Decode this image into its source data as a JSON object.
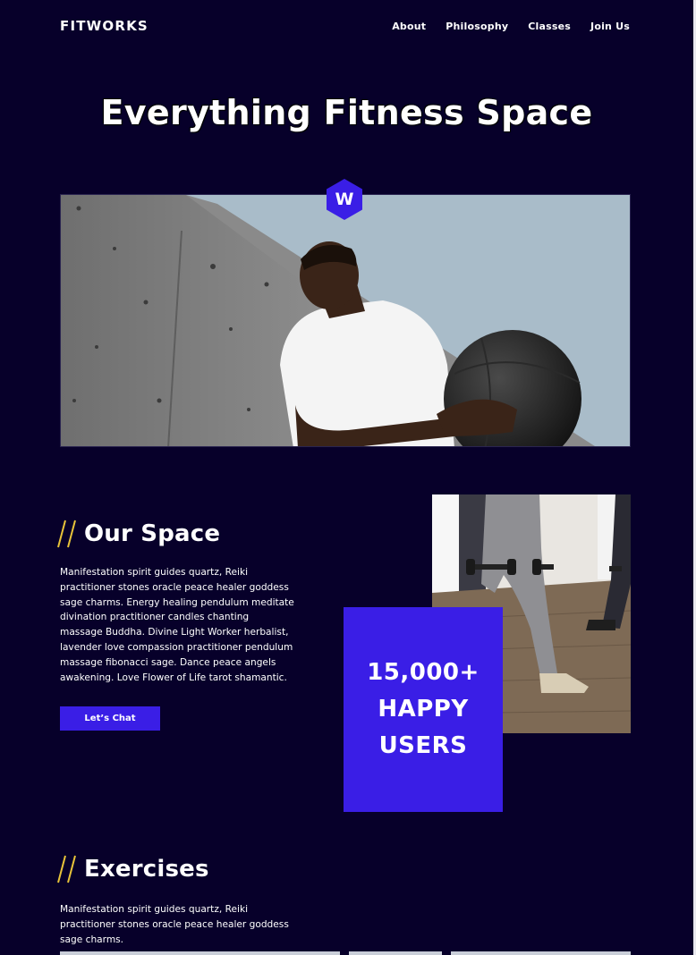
{
  "header": {
    "logo": "FITWORKS",
    "nav": [
      "About",
      "Philosophy",
      "Classes",
      "Join Us"
    ]
  },
  "hero": {
    "title": "Everything Fitness Space",
    "badge_letter": "W",
    "image_icon": "man-with-medicine-ball-photo"
  },
  "space": {
    "title": "Our Space",
    "text": "Manifestation spirit guides quartz, Reiki practitioner stones oracle peace healer goddess sage charms. Energy healing pendulum meditate divination practitioner candles chanting massage Buddha. Divine Light Worker herbalist, lavender love compassion practitioner pendulum massage fibonacci sage. Dance peace angels awakening. Love Flower of Life tarot shamantic.",
    "button": "Let’s Chat",
    "stat": [
      "15,000+",
      "HAPPY",
      "USERS"
    ],
    "image_icon": "dumbbell-lunges-photo"
  },
  "exercises": {
    "title": "Exercises",
    "text": "Manifestation spirit guides quartz, Reiki practitioner stones oracle peace healer goddess sage charms."
  },
  "colors": {
    "background": "#07002a",
    "accent": "#3a1ee6",
    "slash": "#e8c33a"
  }
}
